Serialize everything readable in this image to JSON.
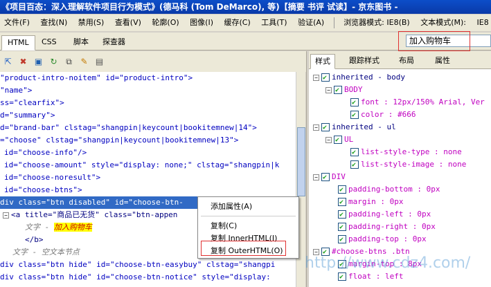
{
  "window": {
    "title": "《项目百态：深入理解软件项目行为模式》(德马科 (Tom DeMarco), 等)【摘要 书评 试读】- 京东图书 -"
  },
  "menu": {
    "items": [
      "文件(F)",
      "查找(N)",
      "禁用(S)",
      "查看(V)",
      "轮廓(O)",
      "图像(I)",
      "缓存(C)",
      "工具(T)",
      "验证(A)"
    ],
    "browser_mode": "浏览器模式: IE8(B)",
    "doc_mode": "文本模式(M):",
    "ie_label": "IE8"
  },
  "tabs": [
    "HTML",
    "CSS",
    "脚本",
    "探查器"
  ],
  "search": {
    "value": "加入购物车"
  },
  "toolbar_icons": [
    "cursor-icon",
    "clear-icon",
    "save-icon",
    "refresh-icon",
    "source-icon",
    "edit-icon",
    "dom-icon"
  ],
  "html_lines": [
    "\"product-intro-noitem\" id=\"product-intro\">",
    "\"name\">",
    "ss=\"clearfix\">",
    "d=\"summary\">",
    "d=\"brand-bar\" clstag=\"shangpin|keycount|bookitemnew|14\">",
    "=\"choose\" clstag=\"shangpin|keycount|bookitemnew|13\">",
    "id=\"choose-info\"/>",
    "id=\"choose-amount\" style=\"display: none;\" clstag=\"shangpin|k",
    "id=\"choose-noresult\">",
    "id=\"choose-btns\">",
    "div class=\"btn disabled\" id=\"choose-btn-",
    "<a title=\"商品已无货\" class=\"btn-appen",
    "文字 - ",
    "</b>",
    "文字 - 空文本节点",
    "div class=\"btn hide\" id=\"choose-btn-easybuy\" clstag=\"shangpi",
    "div class=\"btn hide\" id=\"choose-btn-notice\" style=\"display:"
  ],
  "highlight_text": "加入购物车",
  "right_tabs": [
    "样式",
    "跟踪样式",
    "布局",
    "属性"
  ],
  "styles": [
    {
      "label": "inherited - body",
      "kind": "rule"
    },
    {
      "label": "BODY",
      "kind": "selector"
    },
    {
      "label": "font : 12px/150% Arial, Ver",
      "kind": "prop"
    },
    {
      "label": "color : #666",
      "kind": "prop"
    },
    {
      "label": "inherited - ul",
      "kind": "rule"
    },
    {
      "label": "UL",
      "kind": "selector"
    },
    {
      "label": "list-style-type : none",
      "kind": "prop"
    },
    {
      "label": "list-style-image : none",
      "kind": "prop"
    },
    {
      "label": "DIV",
      "kind": "selector"
    },
    {
      "label": "padding-bottom : 0px",
      "kind": "prop"
    },
    {
      "label": "margin : 0px",
      "kind": "prop"
    },
    {
      "label": "padding-left : 0px",
      "kind": "prop"
    },
    {
      "label": "padding-right : 0px",
      "kind": "prop"
    },
    {
      "label": "padding-top : 0px",
      "kind": "prop"
    },
    {
      "label": "#choose-btns .btn",
      "kind": "selector"
    },
    {
      "label": "margin-top : 8px",
      "kind": "prop"
    },
    {
      "label": "float : left",
      "kind": "prop"
    }
  ],
  "context_menu": [
    "添加属性(A)",
    "复制(C)",
    "复制 InnerHTML(I)",
    "复制 OuterHTML(O)"
  ],
  "watermark": "http://www.cdz4.com/"
}
